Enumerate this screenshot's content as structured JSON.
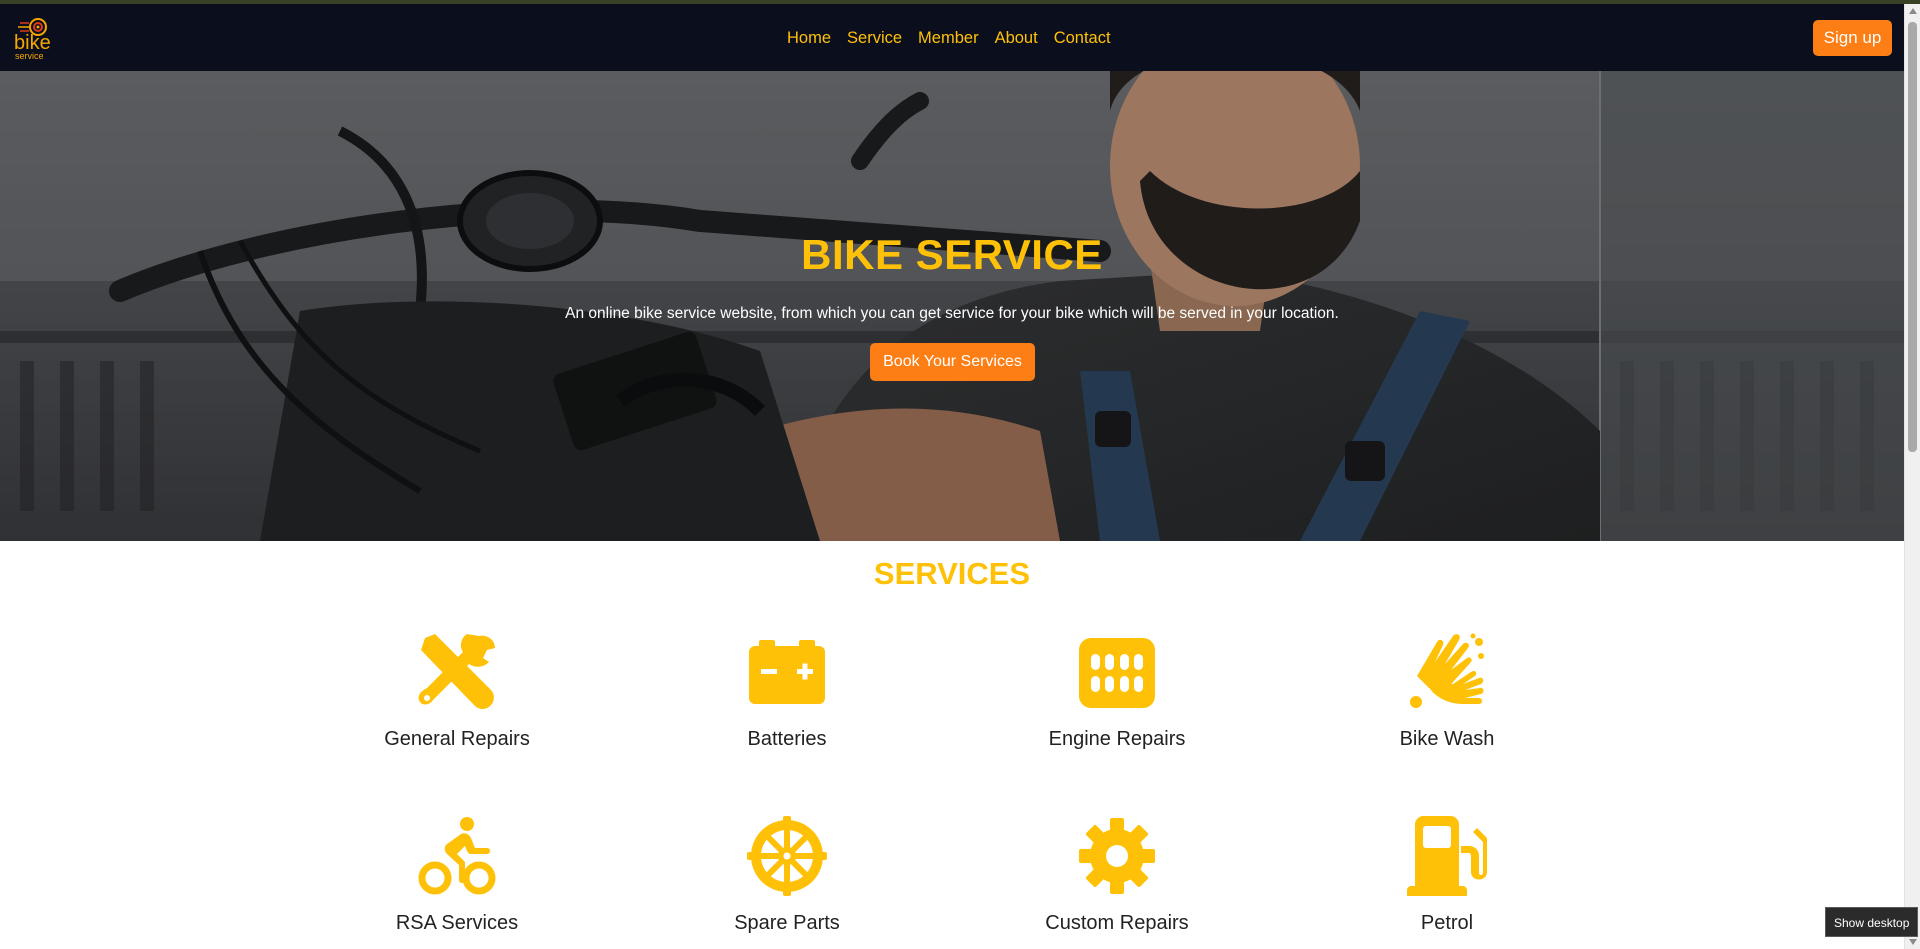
{
  "logo": {
    "line1": "bike",
    "line2": "service"
  },
  "nav": {
    "items": [
      {
        "label": "Home"
      },
      {
        "label": "Service"
      },
      {
        "label": "Member"
      },
      {
        "label": "About"
      },
      {
        "label": "Contact"
      }
    ],
    "signup_label": "Sign up"
  },
  "hero": {
    "title": "BIKE SERVICE",
    "description": "An online bike service website, from which you can get service for your bike which will be served in your location.",
    "button_label": "Book Your Services"
  },
  "services": {
    "title": "SERVICES",
    "items": [
      {
        "label": "General Repairs",
        "icon": "wrench-screwdriver-icon"
      },
      {
        "label": "Batteries",
        "icon": "car-battery-icon"
      },
      {
        "label": "Engine Repairs",
        "icon": "engine-grid-icon"
      },
      {
        "label": "Bike Wash",
        "icon": "hands-wash-icon"
      },
      {
        "label": "RSA Services",
        "icon": "cyclist-icon"
      },
      {
        "label": "Spare Parts",
        "icon": "dharmachakra-wheel-icon"
      },
      {
        "label": "Custom Repairs",
        "icon": "gear-icon"
      },
      {
        "label": "Petrol",
        "icon": "gas-pump-icon"
      }
    ]
  },
  "tooltip": {
    "label": "Show desktop"
  },
  "colors": {
    "accent_yellow": "#ffc107",
    "accent_orange": "#fd7e14",
    "navbar": "#0b0e1c"
  }
}
